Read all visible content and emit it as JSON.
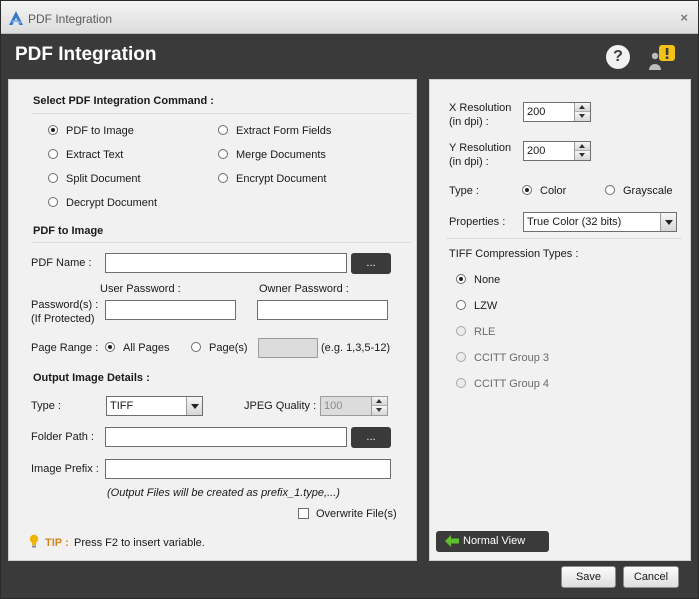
{
  "window": {
    "title": "PDF Integration",
    "close_glyph": "×"
  },
  "header": {
    "title": "PDF Integration",
    "help_glyph": "?"
  },
  "command": {
    "heading": "Select PDF Integration Command :",
    "options": [
      "PDF to Image",
      "Extract Text",
      "Split Document",
      "Decrypt Document",
      "Extract Form Fields",
      "Merge Documents",
      "Encrypt Document"
    ],
    "selected": "PDF to Image"
  },
  "pdf_to_image": {
    "heading": "PDF to Image",
    "pdf_name_label": "PDF Name :",
    "pdf_name_value": "",
    "browse_label": "...",
    "password_label_1": "Password(s) :",
    "password_label_2": "(If Protected)",
    "user_password_label": "User Password :",
    "owner_password_label": "Owner Password :",
    "page_range_label": "Page Range :",
    "all_pages_label": "All Pages",
    "pages_label": "Page(s)",
    "page_range_hint": "(e.g. 1,3,5-12)"
  },
  "output": {
    "heading": "Output Image Details :",
    "type_label": "Type :",
    "type_value": "TIFF",
    "jpeg_quality_label": "JPEG Quality :",
    "jpeg_quality_value": "100",
    "folder_path_label": "Folder Path :",
    "folder_browse_label": "...",
    "image_prefix_label": "Image Prefix :",
    "note": "(Output Files will be created as prefix_1.type,...)",
    "overwrite_label": "Overwrite File(s)"
  },
  "tip": {
    "label": "TIP :",
    "text": "Press F2 to insert variable."
  },
  "settings": {
    "x_res_label_1": "X Resolution",
    "x_res_label_2": "(in dpi) :",
    "x_res_value": "200",
    "y_res_label_1": "Y Resolution",
    "y_res_label_2": "(in dpi) :",
    "y_res_value": "200",
    "type_label": "Type :",
    "color_label": "Color",
    "grayscale_label": "Grayscale",
    "properties_label": "Properties :",
    "properties_value": "True Color (32 bits)",
    "tiff_heading": "TIFF Compression Types :",
    "tiff_options": [
      "None",
      "LZW",
      "RLE",
      "CCITT Group 3",
      "CCITT Group 4"
    ],
    "tiff_selected": "None"
  },
  "footer": {
    "normal_view_label": "Normal View",
    "save_label": "Save",
    "cancel_label": "Cancel"
  },
  "colors": {
    "chrome": "#3a3a3a",
    "panel": "#f1f1f1",
    "tip_bulb": "#f0b400",
    "tip_label": "#d4861a",
    "arrow_green": "#5fbf2f",
    "alert_yellow": "#f3c21a"
  }
}
